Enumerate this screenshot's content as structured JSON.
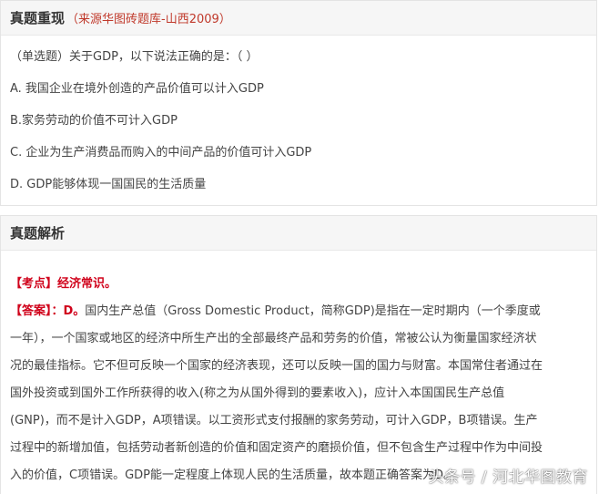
{
  "question_section": {
    "title": "真题重现",
    "source": "（来源华图砖题库-山西2009）",
    "prompt": "（单选题）关于GDP，以下说法正确的是：（ ）",
    "options": [
      "A. 我国企业在境外创造的产品价值可以计入GDP",
      "B.家务劳动的价值不可计入GDP",
      "C. 企业为生产消费品而购入的中间产品的价值可计入GDP",
      "D. GDP能够体现一国国民的生活质量"
    ]
  },
  "analysis_section": {
    "title": "真题解析",
    "point_label": "【考点】经济常识。",
    "answer_label": "【答案】：D。",
    "answer_first_line": "国内生产总值（Gross Domestic Product，简称GDP)是指在一定时期内（一个季度或",
    "lines": [
      "一年），一个国家或地区的经济中所生产出的全部最终产品和劳务的价值，常被公认为衡量国家经济状",
      "况的最佳指标。它不但可反映一个国家的经济表现，还可以反映一国的国力与财富。本国常住者通过在",
      "国外投资或到国外工作所获得的收入(称之为从国外得到的要素收入)，应计入本国国民生产总值",
      "(GNP)，而不是计入GDP，A项错误。以工资形式支付报酬的家务劳动，可计入GDP，B项错误。生产",
      "过程中的新增加值，包括劳动者新创造的价值和固定资产的磨损价值，但不包含生产过程中作为中间投",
      "入的价值，C项错误。GDP能一定程度上体现人民的生活质量，故本题正确答案为D。"
    ]
  },
  "watermark": "头条号 / 河北华图教育",
  "colors": {
    "accent_red": "#d0021b",
    "source_red": "#c0392b",
    "header_bg": "#f6f6f6",
    "border": "#e4e4e4"
  }
}
